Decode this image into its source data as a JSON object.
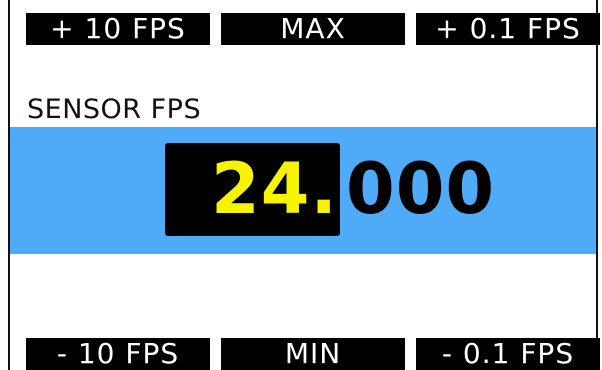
{
  "parameter": {
    "label": "SENSOR FPS",
    "value_integer": "24.",
    "value_fraction": "000"
  },
  "top_buttons": {
    "left": "+ 10 FPS",
    "middle": "MAX",
    "right": "+ 0.1 FPS"
  },
  "bottom_buttons": {
    "left": "- 10 FPS",
    "middle": "MIN",
    "right": "- 0.1 FPS"
  },
  "colors": {
    "value_band": "#4faaf7",
    "active_digits": "#f8f400",
    "button_background": "#000000",
    "button_text": "#ffffff"
  }
}
